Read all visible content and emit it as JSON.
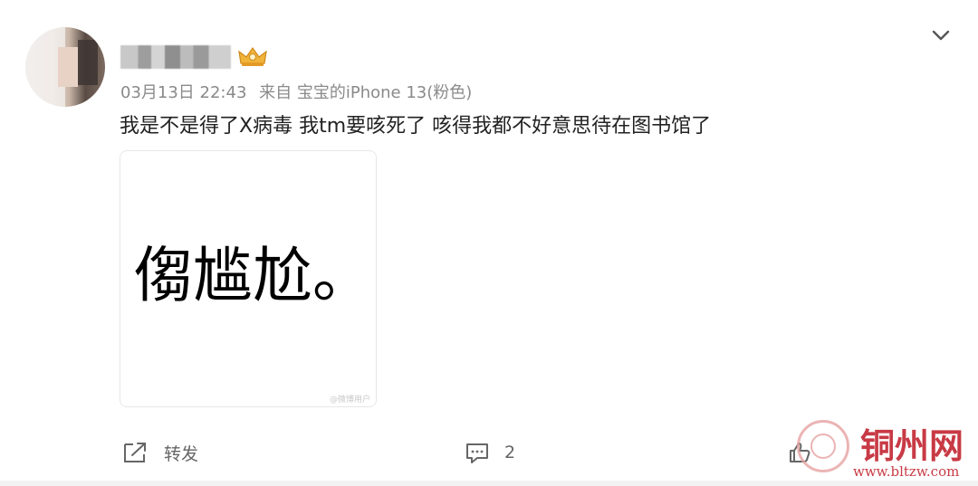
{
  "post": {
    "timestamp": "03月13日 22:43",
    "source": "来自 宝宝的iPhone 13(粉色)",
    "text": "我是不是得了X病毒󠀠 我tm要咳死了 咳得我都不好意思待在图书馆了",
    "image_text": "㑳尴尬。",
    "image_watermark": "@微博用户"
  },
  "actions": {
    "share_label": "转发",
    "comment_count": "2"
  },
  "watermark": {
    "site_name": "铜州网",
    "site_url": "www.bltzw.com"
  },
  "icons": {
    "collapse": "chevron-down-icon",
    "share": "share-icon",
    "comment": "comment-icon",
    "like": "thumb-up-icon",
    "badge": "crown-icon"
  },
  "colors": {
    "primary_text": "#222222",
    "meta_text": "#8a8a8a",
    "watermark_red": "#c83a45"
  }
}
